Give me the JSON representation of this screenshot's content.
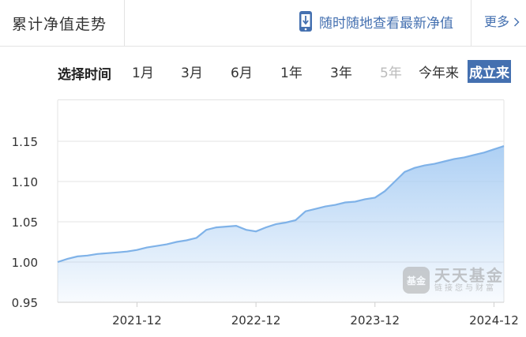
{
  "header": {
    "title": "累计净值走势",
    "mobile_link": "随时随地查看最新净值",
    "more_label": "更多",
    "more_icon": "chevron-right-icon",
    "phone_icon": "phone-download-icon"
  },
  "timebar": {
    "label": "选择时间",
    "options": [
      {
        "label": "1月",
        "state": "normal"
      },
      {
        "label": "3月",
        "state": "normal"
      },
      {
        "label": "6月",
        "state": "normal"
      },
      {
        "label": "1年",
        "state": "normal"
      },
      {
        "label": "3年",
        "state": "normal"
      },
      {
        "label": "5年",
        "state": "disabled"
      },
      {
        "label": "今年来",
        "state": "normal"
      },
      {
        "label": "成立来",
        "state": "active"
      }
    ],
    "active_color": "#4470b0"
  },
  "watermark": {
    "badge": "基金",
    "title": "天天基金",
    "subtitle": "链接您与财富"
  },
  "chart_data": {
    "type": "area",
    "title": "",
    "xlabel": "",
    "ylabel": "",
    "ylim": [
      0.95,
      1.15
    ],
    "yticks": [
      0.95,
      1.0,
      1.05,
      1.1,
      1.15
    ],
    "ytick_labels": [
      "0.95",
      "1.00",
      "1.05",
      "1.10",
      "1.15"
    ],
    "xlim": [
      "2021-04",
      "2025-01"
    ],
    "xticks": [
      "2021-12",
      "2022-12",
      "2023-12",
      "2024-12"
    ],
    "grid": true,
    "line_color": "#7fb2e8",
    "fill_color": "#a9cdf3",
    "series": [
      {
        "x": [
          "2021-04",
          "2021-05",
          "2021-06",
          "2021-07",
          "2021-08",
          "2021-09",
          "2021-10",
          "2021-11",
          "2021-12",
          "2022-01",
          "2022-02",
          "2022-03",
          "2022-04",
          "2022-05",
          "2022-06",
          "2022-07",
          "2022-08",
          "2022-09",
          "2022-10",
          "2022-11",
          "2022-12",
          "2023-01",
          "2023-02",
          "2023-03",
          "2023-04",
          "2023-05",
          "2023-06",
          "2023-07",
          "2023-08",
          "2023-09",
          "2023-10",
          "2023-11",
          "2023-12",
          "2024-01",
          "2024-02",
          "2024-03",
          "2024-04",
          "2024-05",
          "2024-06",
          "2024-07",
          "2024-08",
          "2024-09",
          "2024-10",
          "2024-11",
          "2024-12",
          "2025-01"
        ],
        "values": [
          1.0,
          1.004,
          1.007,
          1.008,
          1.01,
          1.011,
          1.012,
          1.013,
          1.015,
          1.018,
          1.02,
          1.022,
          1.025,
          1.027,
          1.03,
          1.04,
          1.043,
          1.044,
          1.045,
          1.04,
          1.038,
          1.043,
          1.047,
          1.049,
          1.052,
          1.063,
          1.066,
          1.069,
          1.071,
          1.074,
          1.075,
          1.078,
          1.08,
          1.088,
          1.1,
          1.112,
          1.117,
          1.12,
          1.122,
          1.125,
          1.128,
          1.13,
          1.133,
          1.136,
          1.14,
          1.144
        ]
      }
    ]
  }
}
